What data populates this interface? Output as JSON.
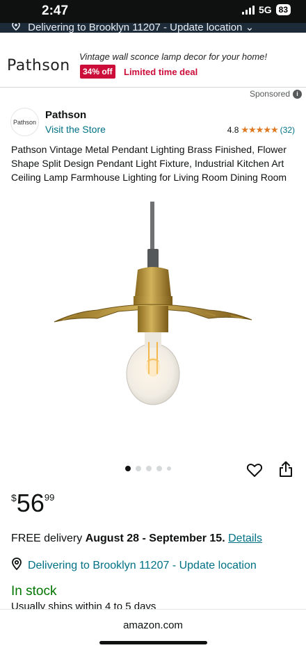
{
  "status": {
    "time": "2:47",
    "network": "5G",
    "battery": "83"
  },
  "location_bar": {
    "text": "Delivering to Brooklyn 11207 - Update location"
  },
  "ad": {
    "logo": "Pathson",
    "tagline": "Vintage wall sconce lamp decor for your home!",
    "discount": "34% off",
    "deal": "Limited time deal"
  },
  "sponsored": {
    "label": "Sponsored",
    "icon": "info-icon"
  },
  "store": {
    "logo_text": "Pathson",
    "name": "Pathson",
    "visit": "Visit the Store",
    "rating": "4.8",
    "stars": "★★★★★",
    "rating_count": "(32)"
  },
  "product": {
    "title": "Pathson Vintage Metal Pendant Lighting Brass Finished, Flower Shape Split Design Pendant Light Fixture, Industrial Kitchen Art Ceiling Lamp Farmhouse Lighting for Living Room Dining Room",
    "image_count": 5,
    "image_active": 1
  },
  "price": {
    "currency": "$",
    "whole": "56",
    "fraction": "99"
  },
  "delivery": {
    "prefix": "FREE delivery",
    "dates": "August 28 - September 15.",
    "details": "Details"
  },
  "deliver_to": "Delivering to Brooklyn 11207 - Update location",
  "stock": {
    "status": "In stock",
    "ships": "Usually ships within 4 to 5 days"
  },
  "footer": {
    "domain": "amazon.com"
  },
  "colors": {
    "link": "#007185",
    "deal_red": "#CC0C39",
    "star": "#DE7921",
    "in_stock": "#007600"
  }
}
